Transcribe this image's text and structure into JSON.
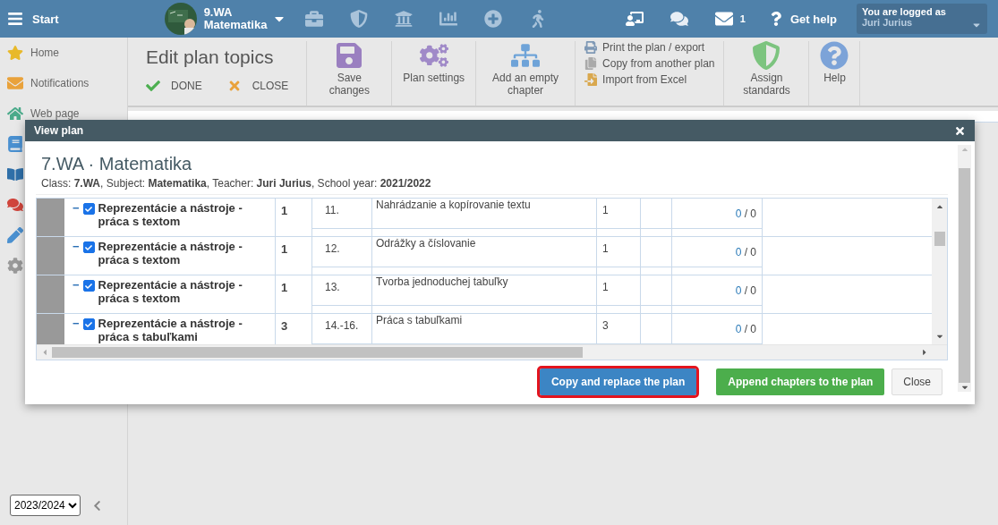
{
  "topbar": {
    "start": "Start",
    "class_name": "9.WA",
    "subject": "Matematika",
    "mail_count": "1",
    "help": "Get help",
    "user_caption": "You are logged as",
    "user_name": "Juri Jurius"
  },
  "sidebar": {
    "items": [
      {
        "label": "Home",
        "kind": "star"
      },
      {
        "label": "Notifications",
        "kind": "mail"
      },
      {
        "label": "Web page",
        "kind": "home"
      },
      {
        "kind": "notebook"
      },
      {
        "kind": "book"
      },
      {
        "kind": "chat"
      },
      {
        "kind": "pen"
      },
      {
        "kind": "gear"
      }
    ],
    "year": "2023/2024"
  },
  "toolbar": {
    "title": "Edit plan topics",
    "done": "DONE",
    "close": "CLOSE",
    "buttons": [
      {
        "label": "Save changes",
        "kind": "save"
      },
      {
        "label": "Plan settings",
        "kind": "settings"
      },
      {
        "label": "Add an empty chapter",
        "kind": "chapter"
      }
    ],
    "links": [
      {
        "label": "Print the plan / export",
        "kind": "print"
      },
      {
        "label": "Copy from another plan",
        "kind": "copy"
      },
      {
        "label": "Import from Excel",
        "kind": "import"
      }
    ],
    "buttons2": [
      {
        "label": "Assign standards",
        "kind": "standards"
      },
      {
        "label": "Help",
        "kind": "help"
      }
    ]
  },
  "dialog": {
    "title": "View plan",
    "heading": "7.WA · Matematika",
    "subtitle": "Class: **7.WA**, Subject: **Matematika**, Teacher: **Juri Jurius**, School year: **2021/2022**",
    "rows": [
      {
        "toggle": "−",
        "checked": true,
        "chapter": "Reprezentácie a nástroje - práca s textom",
        "lessons": "1",
        "number": "11.",
        "topic": "Nahrádzanie a kopírovanie textu",
        "topic_lessons": "1",
        "progress_done": "0",
        "progress_rest": "/ 0"
      },
      {
        "toggle": "−",
        "checked": true,
        "chapter": "Reprezentácie a nástroje - práca s textom",
        "lessons": "1",
        "number": "12.",
        "topic": "Odrážky a číslovanie",
        "topic_lessons": "1",
        "progress_done": "0",
        "progress_rest": "/ 0"
      },
      {
        "toggle": "−",
        "checked": true,
        "chapter": "Reprezentácie a nástroje - práca s textom",
        "lessons": "1",
        "number": "13.",
        "topic": "Tvorba jednoduchej tabuľky",
        "topic_lessons": "1",
        "progress_done": "0",
        "progress_rest": "/ 0"
      },
      {
        "toggle": "−",
        "checked": true,
        "chapter": "Reprezentácie a nástroje - práca s tabuľkami",
        "lessons": "3",
        "number": "14.-16.",
        "topic": "Práca s tabuľkami",
        "topic_lessons": "3",
        "progress_done": "0",
        "progress_rest": "/ 0"
      }
    ],
    "buttons": [
      {
        "label": "Copy and replace the plan",
        "kind": "primary",
        "highlighted": true
      },
      {
        "label": "Append chapters to the plan",
        "kind": "success",
        "highlighted": false
      },
      {
        "label": "Close",
        "kind": "default",
        "highlighted": false
      }
    ]
  }
}
